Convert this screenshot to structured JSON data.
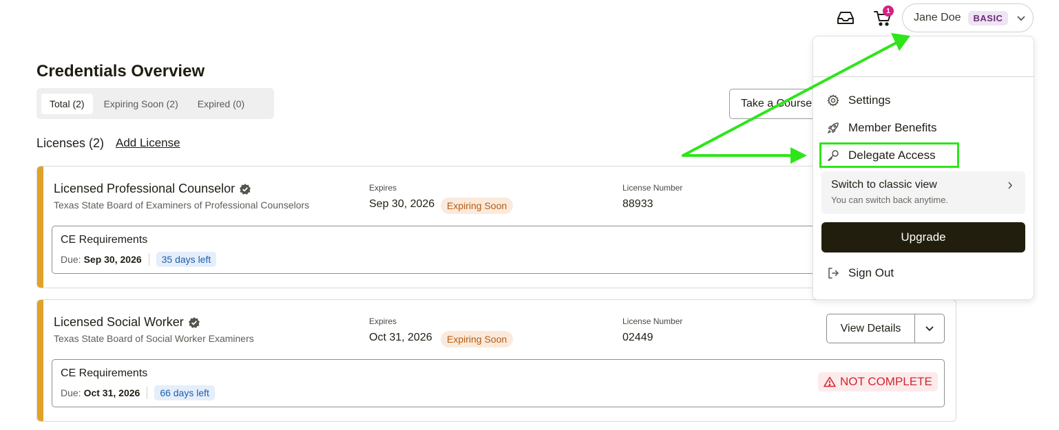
{
  "header": {
    "cart_count": "1",
    "user_name": "Jane Doe",
    "plan": "BASIC"
  },
  "page": {
    "title": "Credentials Overview",
    "tabs": [
      {
        "label": "Total  (2)"
      },
      {
        "label": "Expiring Soon (2)"
      },
      {
        "label": "Expired (0)"
      }
    ],
    "course_button": "Take a Course",
    "licenses_heading": "Licenses (2)",
    "add_license": "Add License"
  },
  "licenses": [
    {
      "title": "Licensed Professional Counselor",
      "board": "Texas State Board of Examiners of Professional Counselors",
      "expires_label": "Expires",
      "expires": "Sep 30, 2026",
      "status": "Expiring Soon",
      "number_label": "License Number",
      "number": "88933",
      "ce_title": "CE Requirements",
      "due_label": "Due:",
      "due": "Sep 30, 2026",
      "days_left": "35 days left"
    },
    {
      "title": "Licensed Social Worker",
      "board": "Texas State Board of Social Worker Examiners",
      "expires_label": "Expires",
      "expires": "Oct 31, 2026",
      "status": "Expiring Soon",
      "number_label": "License Number",
      "number": "02449",
      "ce_title": "CE Requirements",
      "due_label": "Due:",
      "due": "Oct 31, 2026",
      "days_left": "66 days left",
      "view_details": "View Details",
      "ce_status": "NOT COMPLETE"
    }
  ],
  "menu": {
    "settings": "Settings",
    "member_benefits": "Member Benefits",
    "delegate_access": "Delegate Access",
    "classic_title": "Switch to classic view",
    "classic_sub": "You can switch back anytime.",
    "upgrade": "Upgrade",
    "sign_out": "Sign Out"
  },
  "colors": {
    "accent_bar": "#e0a229",
    "highlight": "#2ee51a",
    "upgrade_bg": "#221e0d",
    "warning": "#d1242f"
  }
}
